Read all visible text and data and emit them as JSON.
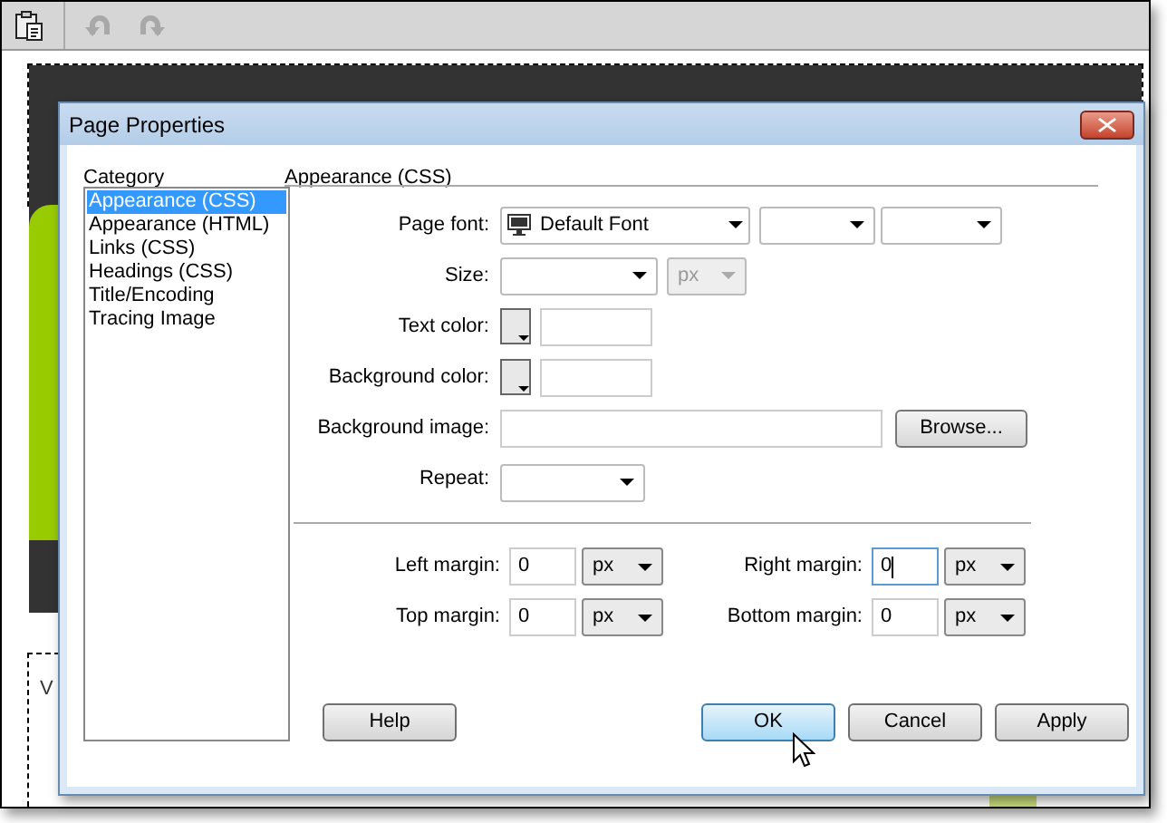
{
  "toolbar": [
    {
      "kind": "paste",
      "disabled": false
    },
    {
      "kind": "undo",
      "disabled": true
    },
    {
      "kind": "redo",
      "disabled": true
    }
  ],
  "canvas_text": "V",
  "dialog": {
    "title": "Page Properties",
    "category": {
      "label": "Category",
      "items": [
        {
          "label": "Appearance (CSS)",
          "selected": true
        },
        {
          "label": "Appearance (HTML)",
          "selected": false
        },
        {
          "label": "Links (CSS)",
          "selected": false
        },
        {
          "label": "Headings (CSS)",
          "selected": false
        },
        {
          "label": "Title/Encoding",
          "selected": false
        },
        {
          "label": "Tracing Image",
          "selected": false
        }
      ]
    },
    "section_title": "Appearance (CSS)",
    "rows": [
      {
        "kind": "font",
        "label": "Page font:",
        "value": "Default Font"
      },
      {
        "kind": "size",
        "label": "Size:",
        "unit": "px"
      },
      {
        "kind": "color",
        "label": "Text color:"
      },
      {
        "kind": "color",
        "label": "Background color:"
      },
      {
        "kind": "image",
        "label": "Background image:",
        "button": "Browse..."
      },
      {
        "kind": "repeat",
        "label": "Repeat:"
      }
    ],
    "margins": [
      {
        "label": "Left margin:",
        "value": "0",
        "unit": "px",
        "focused": false
      },
      {
        "label": "Right margin:",
        "value": "0",
        "unit": "px",
        "focused": true
      },
      {
        "label": "Top margin:",
        "value": "0",
        "unit": "px",
        "focused": false
      },
      {
        "label": "Bottom margin:",
        "value": "0",
        "unit": "px",
        "focused": false
      }
    ],
    "buttons": [
      {
        "label": "Help",
        "default": false
      },
      {
        "label": "OK",
        "default": true
      },
      {
        "label": "Cancel",
        "default": false
      },
      {
        "label": "Apply",
        "default": false
      }
    ]
  }
}
